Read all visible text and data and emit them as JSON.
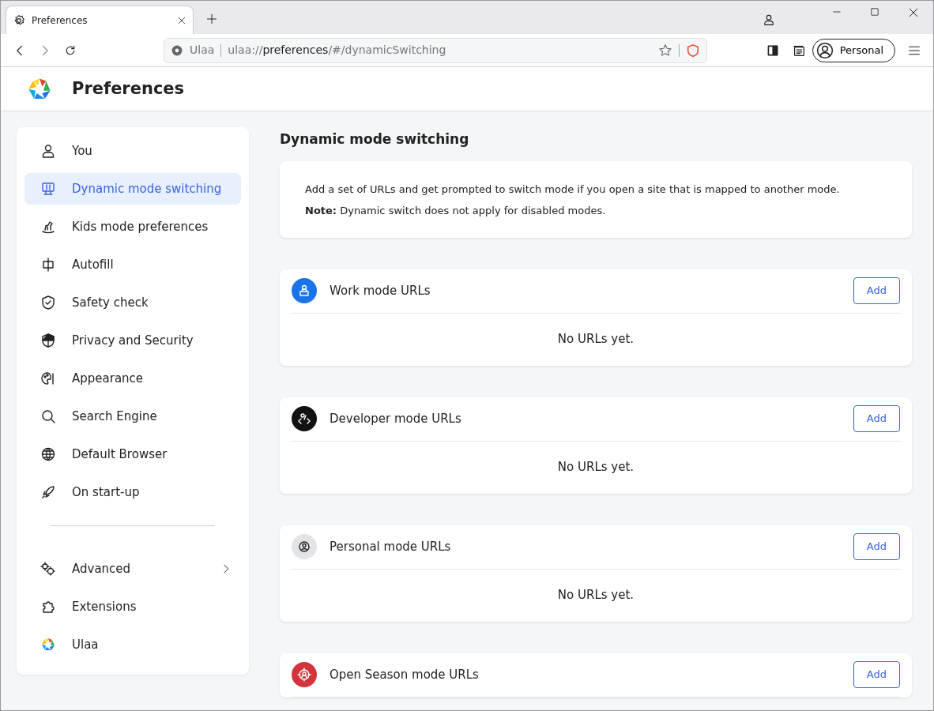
{
  "browser": {
    "tab_title": "Preferences",
    "site_label": "Ulaa",
    "address_prefix": "ulaa://",
    "address_host": "preferences",
    "address_path": "/#/dynamicSwitching",
    "profile": "Personal"
  },
  "header": {
    "title": "Preferences"
  },
  "sidebar": {
    "items": [
      {
        "label": "You",
        "has_chevron": false,
        "selected": false
      },
      {
        "label": "Dynamic mode switching",
        "has_chevron": false,
        "selected": true
      },
      {
        "label": "Kids mode preferences",
        "has_chevron": false,
        "selected": false
      },
      {
        "label": "Autofill",
        "has_chevron": false,
        "selected": false
      },
      {
        "label": "Safety check",
        "has_chevron": false,
        "selected": false
      },
      {
        "label": "Privacy and Security",
        "has_chevron": false,
        "selected": false
      },
      {
        "label": "Appearance",
        "has_chevron": false,
        "selected": false
      },
      {
        "label": "Search Engine",
        "has_chevron": false,
        "selected": false
      },
      {
        "label": "Default Browser",
        "has_chevron": false,
        "selected": false
      },
      {
        "label": "On start-up",
        "has_chevron": false,
        "selected": false
      }
    ],
    "bottom_items": [
      {
        "label": "Advanced",
        "has_chevron": true,
        "selected": false
      },
      {
        "label": "Extensions",
        "has_chevron": false,
        "selected": false
      },
      {
        "label": "Ulaa",
        "has_chevron": false,
        "selected": false
      }
    ]
  },
  "main": {
    "title": "Dynamic mode switching",
    "intro": "Add a set of URLs and get prompted to switch mode if you open a site that is mapped to another mode.",
    "note": "**Note:** Dynamic switch does not apply for disabled modes.",
    "modes": [
      {
        "title": "Work mode URLs",
        "color": "#1a73e8",
        "button": "Add",
        "empty": "No URLs yet."
      },
      {
        "title": "Developer mode URLs",
        "color": "#111111",
        "button": "Add",
        "empty": "No URLs yet."
      },
      {
        "title": "Personal mode URLs",
        "color": "#e3e4e8",
        "button": "Add",
        "empty": "No URLs yet."
      },
      {
        "title": "Open Season mode URLs",
        "color": "#d1343a",
        "button": "Add"
      }
    ]
  }
}
